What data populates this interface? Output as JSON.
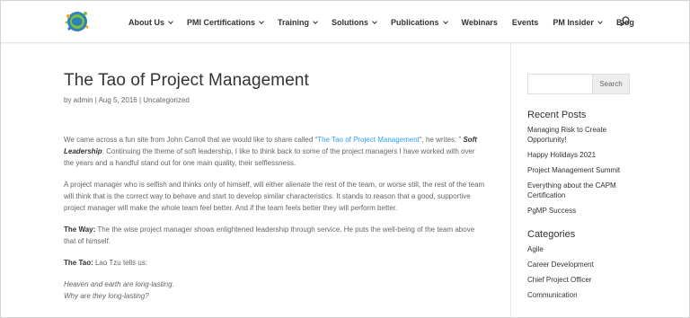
{
  "header": {
    "nav": [
      {
        "label": "About Us",
        "has_dropdown": true
      },
      {
        "label": "PMI Certifications",
        "has_dropdown": true
      },
      {
        "label": "Training",
        "has_dropdown": true
      },
      {
        "label": "Solutions",
        "has_dropdown": true
      },
      {
        "label": "Publications",
        "has_dropdown": true
      },
      {
        "label": "Webinars",
        "has_dropdown": false
      },
      {
        "label": "Events",
        "has_dropdown": false
      },
      {
        "label": "PM Insider",
        "has_dropdown": true
      },
      {
        "label": "Blog",
        "has_dropdown": false
      }
    ],
    "search_icon": "search-icon",
    "logo_icon": "globe-logo"
  },
  "post": {
    "title": "The Tao of Project Management",
    "author": "admin",
    "date": "Aug 5, 2016",
    "category": "Uncategorized",
    "meta_sep": " | ",
    "meta_by": "by ",
    "p1_pre": "We came across a fun site from John Carroll that we would like to share called “",
    "p1_link": "The Tao of Project Management",
    "p1_mid": "“, he writes: ” ",
    "p1_bold": "Soft Leadership",
    "p1_post": ": Continuing the theme of soft leadership, I like to think back to some of the project managers I have worked with over the years and a handful stand out for one main quality, their selflessness.",
    "p2": "A project manager who is selfish and thinks only of himself, will either alienate the rest of the team, or worse still, the rest of the team will think that is the correct way to behave and start to develop similar characteristics.  It stands to reason that a good, supportive project manager will make the whole team feel better.  And if the team feels better they will perform better.",
    "p3_bold": "The Way:",
    "p3_rest": " The the wise project manager shows enlightened leadership through service.  He puts the well-being of the team above that of himself.",
    "p4_bold": "The Tao:",
    "p4_rest": " Lao Tzu tells us:",
    "p5_line1": "Heaven and earth are long-lasting.",
    "p5_line2": "Why are they long-lasting?"
  },
  "sidebar": {
    "search_placeholder": "",
    "search_button": "Search",
    "recent_title": "Recent Posts",
    "recent_posts": [
      "Managing Risk to Create Opportunity!",
      "Happy Holidays 2021",
      "Project Management Summit",
      "Everything about the CAPM Certification",
      "PgMP Success"
    ],
    "categories_title": "Categories",
    "categories": [
      "Agile",
      "Career Development",
      "Chief Project Officer",
      "Communication"
    ]
  },
  "colors": {
    "link": "#2ea3f2",
    "heading": "#333333",
    "text": "#666666"
  }
}
